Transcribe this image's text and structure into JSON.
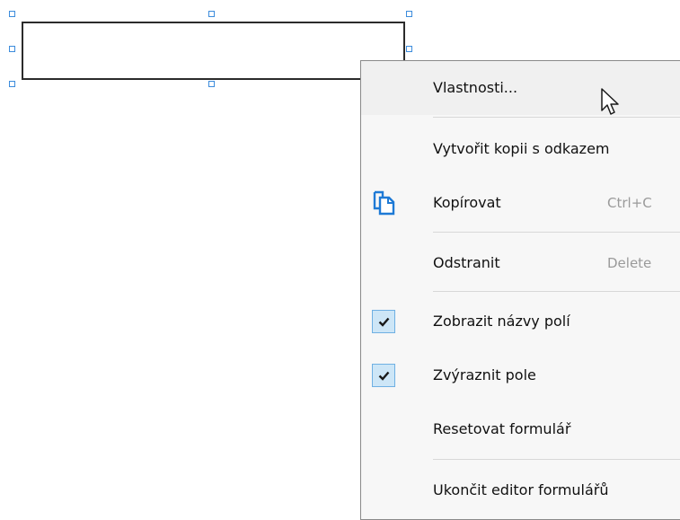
{
  "menu": {
    "items": [
      {
        "label": "Vlastnosti...",
        "shortcut": "",
        "checked": false,
        "icon": ""
      },
      {
        "label": "Vytvořit kopii s odkazem",
        "shortcut": "",
        "checked": false,
        "icon": ""
      },
      {
        "label": "Kopírovat",
        "shortcut": "Ctrl+C",
        "checked": false,
        "icon": "copy-icon"
      },
      {
        "label": "Odstranit",
        "shortcut": "Delete",
        "checked": false,
        "icon": ""
      },
      {
        "label": "Zobrazit názvy polí",
        "shortcut": "",
        "checked": true,
        "icon": ""
      },
      {
        "label": "Zvýraznit pole",
        "shortcut": "",
        "checked": true,
        "icon": ""
      },
      {
        "label": "Resetovat formulář",
        "shortcut": "",
        "checked": false,
        "icon": ""
      },
      {
        "label": "Ukončit editor formulářů",
        "shortcut": "",
        "checked": false,
        "icon": ""
      }
    ]
  },
  "colors": {
    "selection_handle": "#3c8cdc",
    "check_fill": "#cde6f7",
    "check_border": "#6fb0e3",
    "copy_icon": "#1e7ad6"
  }
}
